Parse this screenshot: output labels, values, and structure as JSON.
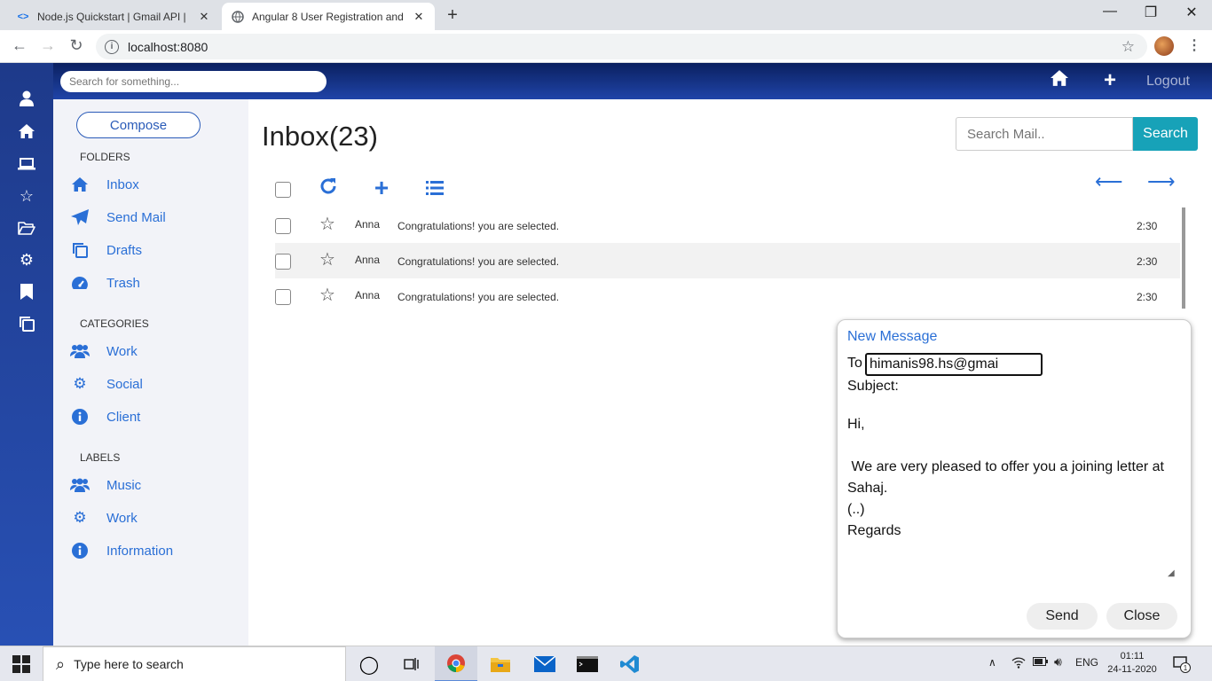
{
  "browser": {
    "tabs": [
      {
        "title": "Node.js Quickstart | Gmail API | "
      },
      {
        "title": "Angular 8 User Registration and "
      }
    ],
    "new_tab": "+",
    "url": "localhost:8080"
  },
  "app_header": {
    "search_placeholder": "Search for something...",
    "logout_label": "Logout"
  },
  "sidebar": {
    "compose_label": "Compose",
    "folders_heading": "FOLDERS",
    "folders": [
      {
        "label": "Inbox",
        "icon": "home-icon"
      },
      {
        "label": "Send Mail",
        "icon": "paper-plane-icon"
      },
      {
        "label": "Drafts",
        "icon": "copy-icon"
      },
      {
        "label": "Trash",
        "icon": "dashboard-icon"
      }
    ],
    "categories_heading": "CATEGORIES",
    "categories": [
      {
        "label": "Work",
        "icon": "users-icon"
      },
      {
        "label": "Social",
        "icon": "gear-icon"
      },
      {
        "label": "Client",
        "icon": "info-icon"
      }
    ],
    "labels_heading": "LABELS",
    "labels": [
      {
        "label": "Music",
        "icon": "users-icon"
      },
      {
        "label": "Work",
        "icon": "gear-icon"
      },
      {
        "label": "Information",
        "icon": "info-icon"
      }
    ]
  },
  "inbox": {
    "title": "Inbox(23)",
    "search_placeholder": "Search Mail..",
    "search_button": "Search",
    "mails": [
      {
        "from": "Anna",
        "subject": "Congratulations! you are selected.",
        "time": "2:30"
      },
      {
        "from": "Anna",
        "subject": "Congratulations! you are selected.",
        "time": "2:30"
      },
      {
        "from": "Anna",
        "subject": "Congratulations! you are selected.",
        "time": "2:30"
      }
    ]
  },
  "compose_window": {
    "title": "New Message",
    "to_label": "To",
    "to_value": "himanis98.hs@gmai",
    "subject_label": "Subject:",
    "body": "Hi,\n\n We are very pleased to offer you a joining letter at Sahaj.\n(..)\nRegards",
    "send_label": "Send",
    "close_label": "Close"
  },
  "taskbar": {
    "search_placeholder": "Type here to search",
    "language": "ENG",
    "time": "01:11",
    "date": "24-11-2020",
    "notification_count": "1"
  },
  "colors": {
    "accent": "#2a6fd6",
    "header_dark": "#0b2060",
    "search_button": "#17a2b8"
  }
}
